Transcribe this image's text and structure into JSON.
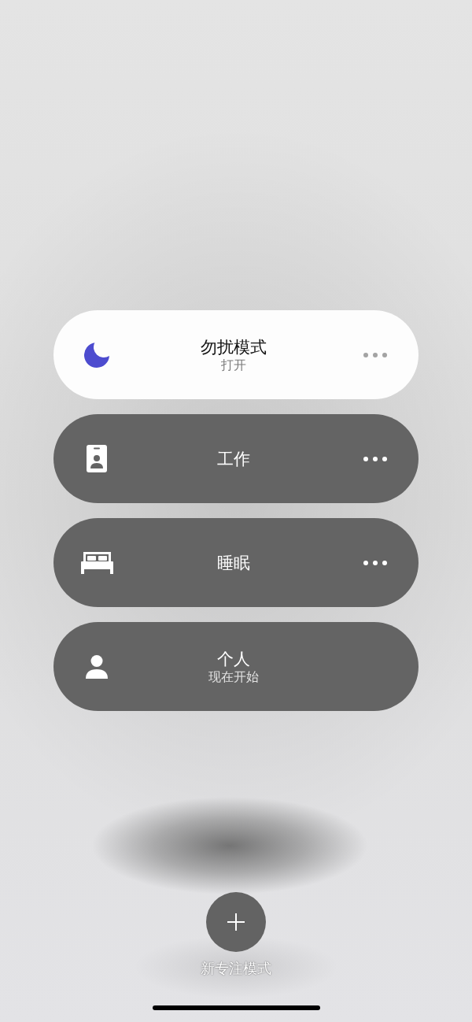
{
  "modes": [
    {
      "kind": "moon",
      "title": "勿扰模式",
      "status": "打开",
      "selected": true,
      "more_button": true
    },
    {
      "kind": "badge",
      "title": "工作",
      "selected": false,
      "more_button": true
    },
    {
      "kind": "bed",
      "title": "睡眠",
      "selected": false,
      "more_button": true
    },
    {
      "kind": "person",
      "title": "个人",
      "status": "现在开始",
      "selected": false,
      "more_button": false
    }
  ],
  "new_mode": {
    "label": "新专注模式"
  }
}
